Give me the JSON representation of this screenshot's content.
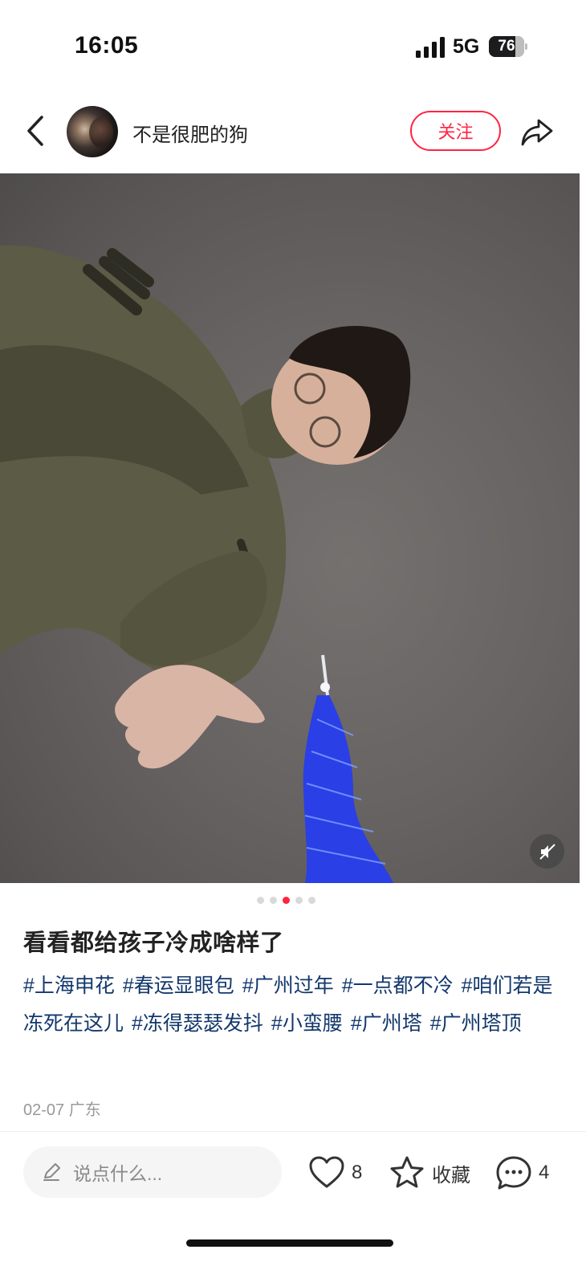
{
  "status_bar": {
    "time": "16:05",
    "network": "5G",
    "battery_percent": 76,
    "battery_text": "76"
  },
  "header": {
    "author_name": "不是很肥的狗",
    "follow_label": "关注",
    "icons": {
      "back": "chevron-left-icon",
      "share": "share-arrow-icon"
    }
  },
  "media": {
    "carousel_total": 5,
    "carousel_active_index": 2,
    "mute_icon": "speaker-muted-icon"
  },
  "post": {
    "title": "看看都给孩子冷成啥样了",
    "tags": [
      "#上海申花",
      "#春运显眼包",
      "#广州过年",
      "#一点都不冷",
      "#咱们若是冻死在这儿",
      "#冻得瑟瑟发抖",
      "#小蛮腰",
      "#广州塔",
      "#广州塔顶"
    ],
    "date": "02-07",
    "location": "广东"
  },
  "bottom_bar": {
    "comment_placeholder": "说点什么...",
    "like_count": "8",
    "collect_label": "收藏",
    "comment_count": "4"
  },
  "colors": {
    "accent": "#ff2442",
    "tag": "#13386c",
    "tower": "#2a3fe6"
  }
}
